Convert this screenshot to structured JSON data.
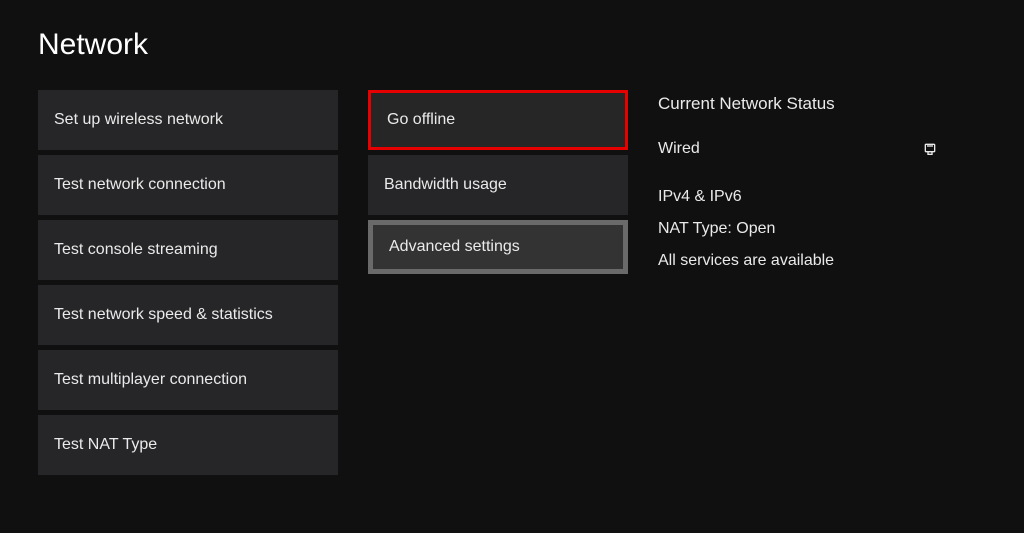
{
  "page": {
    "title": "Network"
  },
  "column1": [
    {
      "label": "Set up wireless network"
    },
    {
      "label": "Test network connection"
    },
    {
      "label": "Test console streaming"
    },
    {
      "label": "Test network speed & statistics"
    },
    {
      "label": "Test multiplayer connection"
    },
    {
      "label": "Test NAT Type"
    }
  ],
  "column2": [
    {
      "label": "Go offline",
      "highlight": "red"
    },
    {
      "label": "Bandwidth usage",
      "highlight": "none"
    },
    {
      "label": "Advanced settings",
      "highlight": "gray"
    }
  ],
  "status": {
    "title": "Current Network Status",
    "connection": "Wired",
    "connection_icon": "ethernet-plug",
    "ip": "IPv4 & IPv6",
    "nat": "NAT Type: Open",
    "services": "All services are available"
  }
}
